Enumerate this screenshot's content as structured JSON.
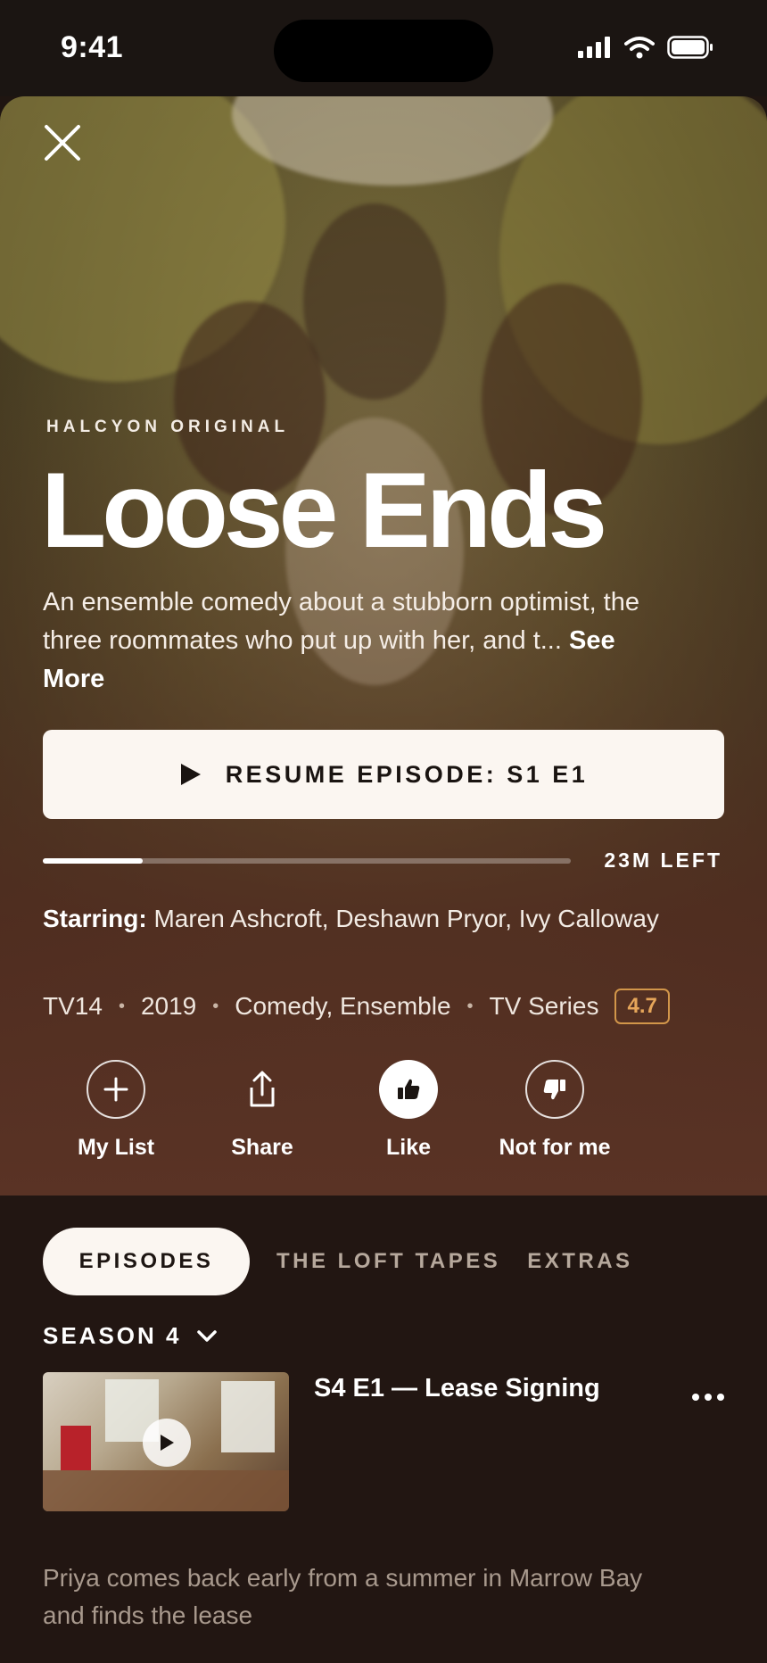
{
  "status": {
    "time": "9:41"
  },
  "hero": {
    "eyebrow": "HALCYON ORIGINAL",
    "title": "Loose Ends",
    "description": "An ensemble comedy about a stubborn optimist, the three roommates who put up with her, and t...",
    "see_more": "See More",
    "resume_label": "RESUME EPISODE: S1 E1",
    "progress_fraction": 0.19,
    "time_left": "23M LEFT",
    "starring_label": "Starring:",
    "starring_names": "Maren Ashcroft, Deshawn Pryor, Ivy Calloway",
    "meta": {
      "rating": "TV14",
      "year": "2019",
      "genres": "Comedy, Ensemble",
      "kind": "TV Series",
      "score": "4.7"
    }
  },
  "actions": {
    "my_list": "My List",
    "share": "Share",
    "like": "Like",
    "not_for_me": "Not for me"
  },
  "tabs": [
    "EPISODES",
    "THE LOFT TAPES",
    "EXTRAS"
  ],
  "season_label": "SEASON 4",
  "episode": {
    "title": "S4 E1 — Lease Signing",
    "description": "Priya comes back early from a summer in Marrow Bay and finds the lease"
  },
  "colors": {
    "accent": "#e6a65a",
    "hero_bottom": "#5a3325",
    "panel": "#221612"
  }
}
